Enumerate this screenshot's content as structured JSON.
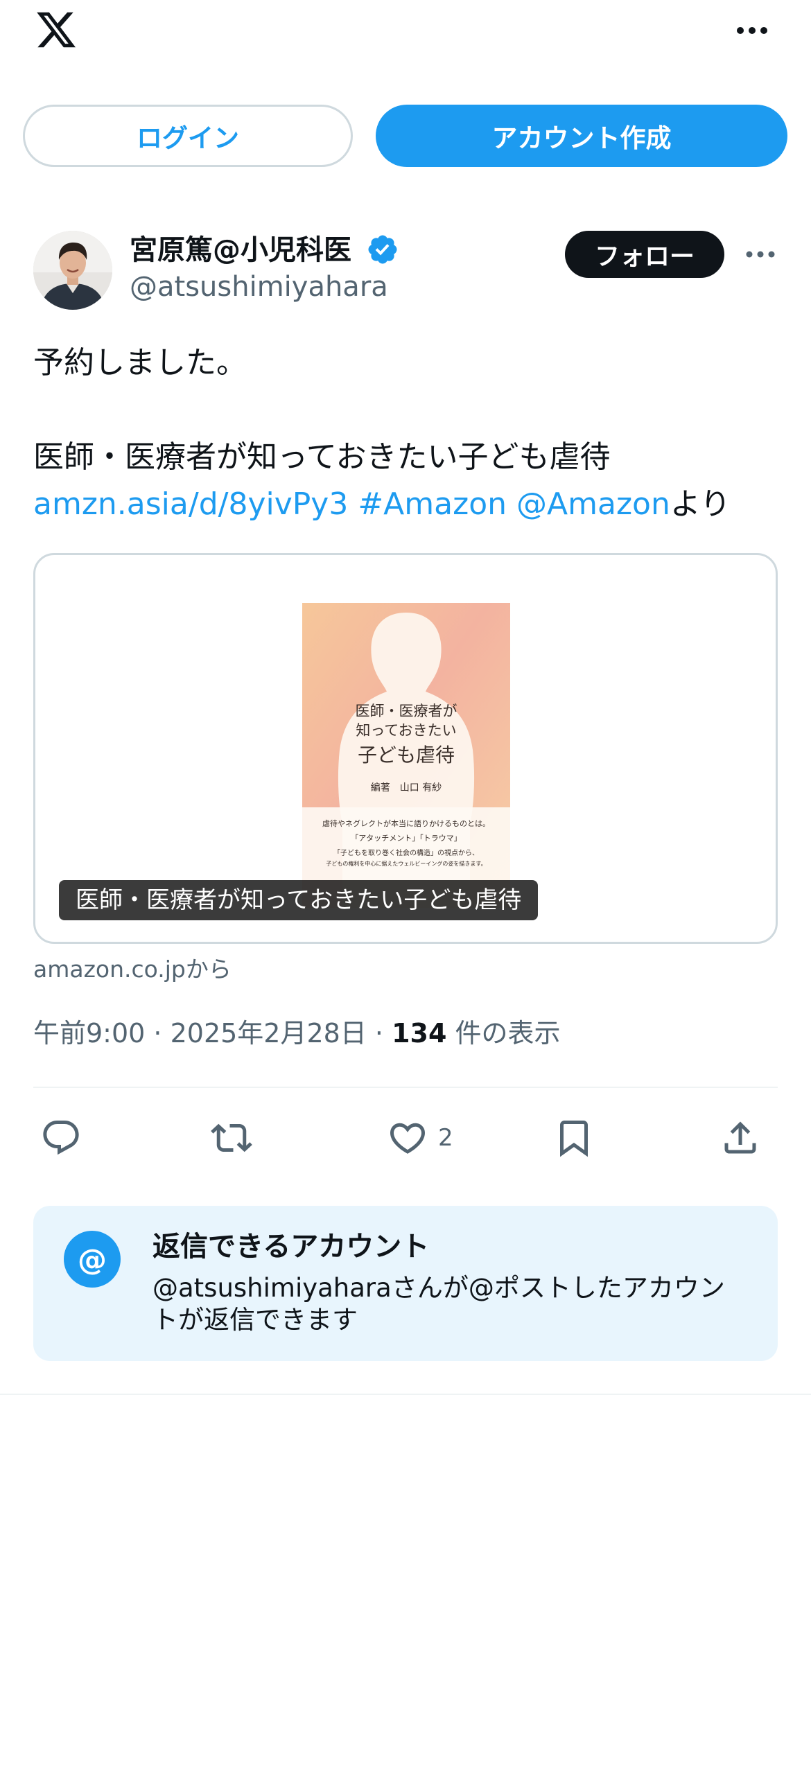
{
  "header": {
    "logo_icon": "x-logo-icon",
    "more_icon": "more-horizontal-icon"
  },
  "auth": {
    "login_label": "ログイン",
    "signup_label": "アカウント作成"
  },
  "post": {
    "author": {
      "name": "宮原篤@小児科医",
      "handle": "@atsushimiyahara",
      "verified": true,
      "verified_color": "#1d9bf0"
    },
    "follow_label": "フォロー",
    "text": {
      "line1": "予約しました。",
      "line2": "医師・医療者が知っておきたい子ども虐待",
      "link_url": "amzn.asia/d/8yivPy3",
      "hashtag": "#Amazon",
      "mention": "@Amazon",
      "suffix": "より"
    },
    "card": {
      "caption": "医師・医療者が知っておきたい子ども虐待",
      "source": "amazon.co.jpから",
      "book": {
        "title_line1": "医師・医療者が",
        "title_line2": "知っておきたい",
        "title_line3": "子ども虐待",
        "editor_label": "編著",
        "editor": "山口 有紗",
        "blurb1": "虐待やネグレクトが本当に語りかけるものとは。",
        "blurb2": "「アタッチメント」「トラウマ」",
        "blurb3": "「子どもを取り巻く社会の構造」の視点から、",
        "blurb4": "子どもの権利を中心に据えたウェルビーイングの姿を描きます。"
      }
    },
    "meta": {
      "time": "午前9:00",
      "sep1": " · ",
      "date": "2025年2月28日",
      "sep2": " · ",
      "views_count": "134",
      "views_label": " 件の表示"
    },
    "actions": {
      "reply_icon": "reply-icon",
      "repost_icon": "repost-icon",
      "like_icon": "heart-icon",
      "like_count": "2",
      "bookmark_icon": "bookmark-icon",
      "share_icon": "share-icon"
    },
    "reply_restriction": {
      "icon": "at-icon",
      "icon_glyph": "@",
      "title": "返信できるアカウント",
      "description": "@atsushimiyaharaさんが@ポストしたアカウントが返信できます"
    }
  },
  "colors": {
    "accent": "#1d9bf0",
    "text": "#0f1419",
    "secondary": "#536471",
    "reply_box_bg": "#e8f5fd"
  }
}
